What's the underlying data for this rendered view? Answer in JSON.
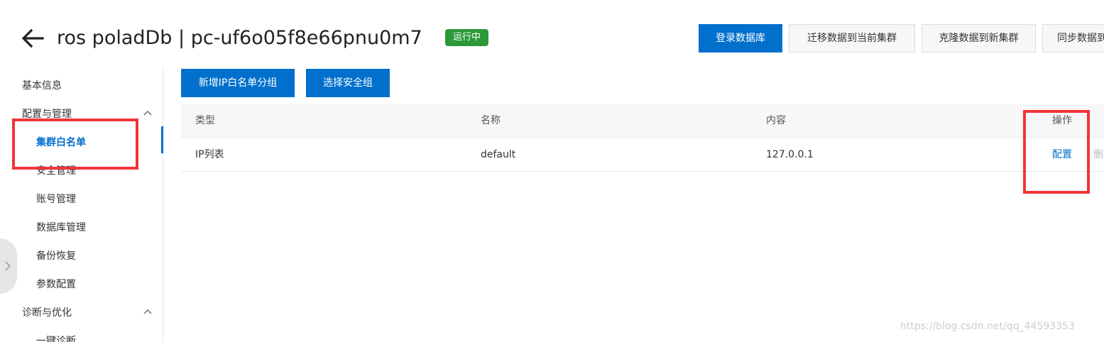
{
  "header": {
    "title": "ros poladDb | pc-uf6o05f8e66pnu0m7",
    "status": "运行中",
    "buttons": {
      "login_db": "登录数据库",
      "migrate_current": "迁移数据到当前集群",
      "clone_new": "克隆数据到新集群",
      "sync": "同步数据到"
    }
  },
  "sidebar": {
    "basic_info": "基本信息",
    "config_manage": "配置与管理",
    "cluster_whitelist": "集群白名单",
    "security_manage": "安全管理",
    "account_manage": "账号管理",
    "database_manage": "数据库管理",
    "backup_restore": "备份恢复",
    "param_config": "参数配置",
    "diag_optimize": "诊断与优化",
    "one_click_diag": "一键诊断"
  },
  "actions": {
    "add_ip_group": "新增IP白名单分组",
    "select_security_group": "选择安全组"
  },
  "table": {
    "headers": {
      "type": "类型",
      "name": "名称",
      "content": "内容",
      "operation": "操作"
    },
    "rows": [
      {
        "type": "IP列表",
        "name": "default",
        "content": "127.0.0.1",
        "config": "配置",
        "delete": "删"
      }
    ]
  },
  "watermark": "https://blog.csdn.net/qq_44593353",
  "colors": {
    "primary": "#0070cc",
    "status": "#2b9939",
    "annotation": "#f0353a"
  }
}
